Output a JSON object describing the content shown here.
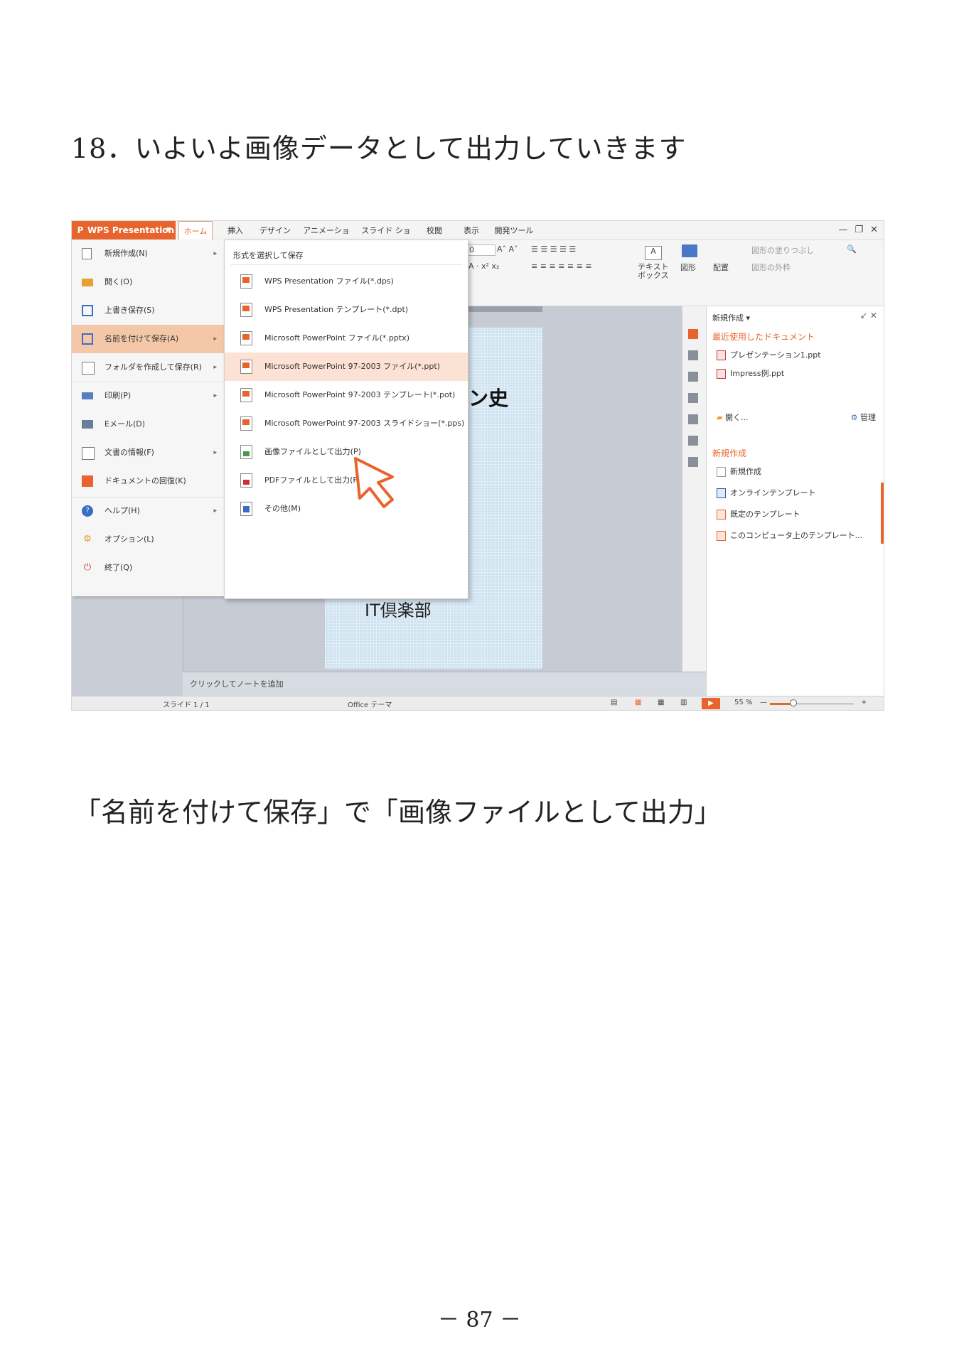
{
  "heading": "18．いよいよ画像データとして出力していきます",
  "caption": "「名前を付けて保存」で「画像ファイルとして出力」",
  "page_number": "－ 87 －",
  "app": {
    "title": "WPS Presentation",
    "tabs": [
      "ホーム",
      "挿入",
      "デザイン",
      "アニメーション",
      "スライド ショー",
      "校閲",
      "表示",
      "開発ツール"
    ],
    "accent": "#e8642c"
  },
  "ribbon": {
    "textbox_label": "テキスト\nボックス",
    "shape_label": "図形",
    "arrange_label": "配置",
    "fill_label": "図形の塗りつぶし",
    "outline_label": "図形の外枠",
    "font_size": "0"
  },
  "main_menu": [
    {
      "label": "新規作成(N)",
      "icon": "new-doc-icon",
      "arrow": true
    },
    {
      "label": "開く(O)",
      "icon": "folder-icon",
      "arrow": false
    },
    {
      "label": "上書き保存(S)",
      "icon": "save-icon",
      "arrow": false
    },
    {
      "label": "名前を付けて保存(A)",
      "icon": "save-as-icon",
      "arrow": true,
      "selected": true
    },
    {
      "label": "フォルダを作成して保存(R)",
      "icon": "folder-save-icon",
      "arrow": true
    },
    {
      "label": "印刷(P)",
      "icon": "printer-icon",
      "arrow": true
    },
    {
      "label": "Eメール(D)",
      "icon": "mail-icon",
      "arrow": false
    },
    {
      "label": "文書の情報(F)",
      "icon": "doc-info-icon",
      "arrow": true
    },
    {
      "label": "ドキュメントの回復(K)",
      "icon": "recover-icon",
      "arrow": false
    },
    {
      "label": "ヘルプ(H)",
      "icon": "help-icon",
      "arrow": true
    },
    {
      "label": "オプション(L)",
      "icon": "gear-icon",
      "arrow": false
    },
    {
      "label": "終了(Q)",
      "icon": "exit-icon",
      "arrow": false
    }
  ],
  "submenu": {
    "title": "形式を選択して保存",
    "items": [
      {
        "label": "WPS Presentation ファイル(*.dps)",
        "icon": "dps-file-icon"
      },
      {
        "label": "WPS Presentation テンプレート(*.dpt)",
        "icon": "dpt-file-icon"
      },
      {
        "label": "Microsoft PowerPoint ファイル(*.pptx)",
        "icon": "pptx-file-icon"
      },
      {
        "label": "Microsoft PowerPoint 97-2003 ファイル(*.ppt)",
        "icon": "ppt-file-icon",
        "selected": true
      },
      {
        "label": "Microsoft PowerPoint 97-2003 テンプレート(*.pot)",
        "icon": "pot-file-icon"
      },
      {
        "label": "Microsoft PowerPoint 97-2003 スライドショー(*.pps)",
        "icon": "pps-file-icon"
      },
      {
        "label": "画像ファイルとして出力(P)",
        "icon": "image-file-icon"
      },
      {
        "label": "PDFファイルとして出力(F)",
        "icon": "pdf-file-icon"
      },
      {
        "label": "その他(M)",
        "icon": "other-file-icon"
      }
    ]
  },
  "slide": {
    "title_fragment": "ン史",
    "subtitle": "IT倶楽部"
  },
  "notes_placeholder": "クリックしてノートを追加",
  "task_pane": {
    "header": "新規作成 ▾",
    "recent_title": "最近使用したドキュメント",
    "recent_files": [
      "プレゼンテーション1.ppt",
      "Impress例.ppt"
    ],
    "open_label": "開く...",
    "manage_label": "管理",
    "new_title": "新規作成",
    "new_items": [
      "新規作成",
      "オンラインテンプレート",
      "既定のテンプレート",
      "このコンピュータ上のテンプレート..."
    ]
  },
  "status": {
    "slide": "スライド 1 / 1",
    "theme": "Office テーマ",
    "zoom": "55 %",
    "zoom_level_percent": 55
  }
}
